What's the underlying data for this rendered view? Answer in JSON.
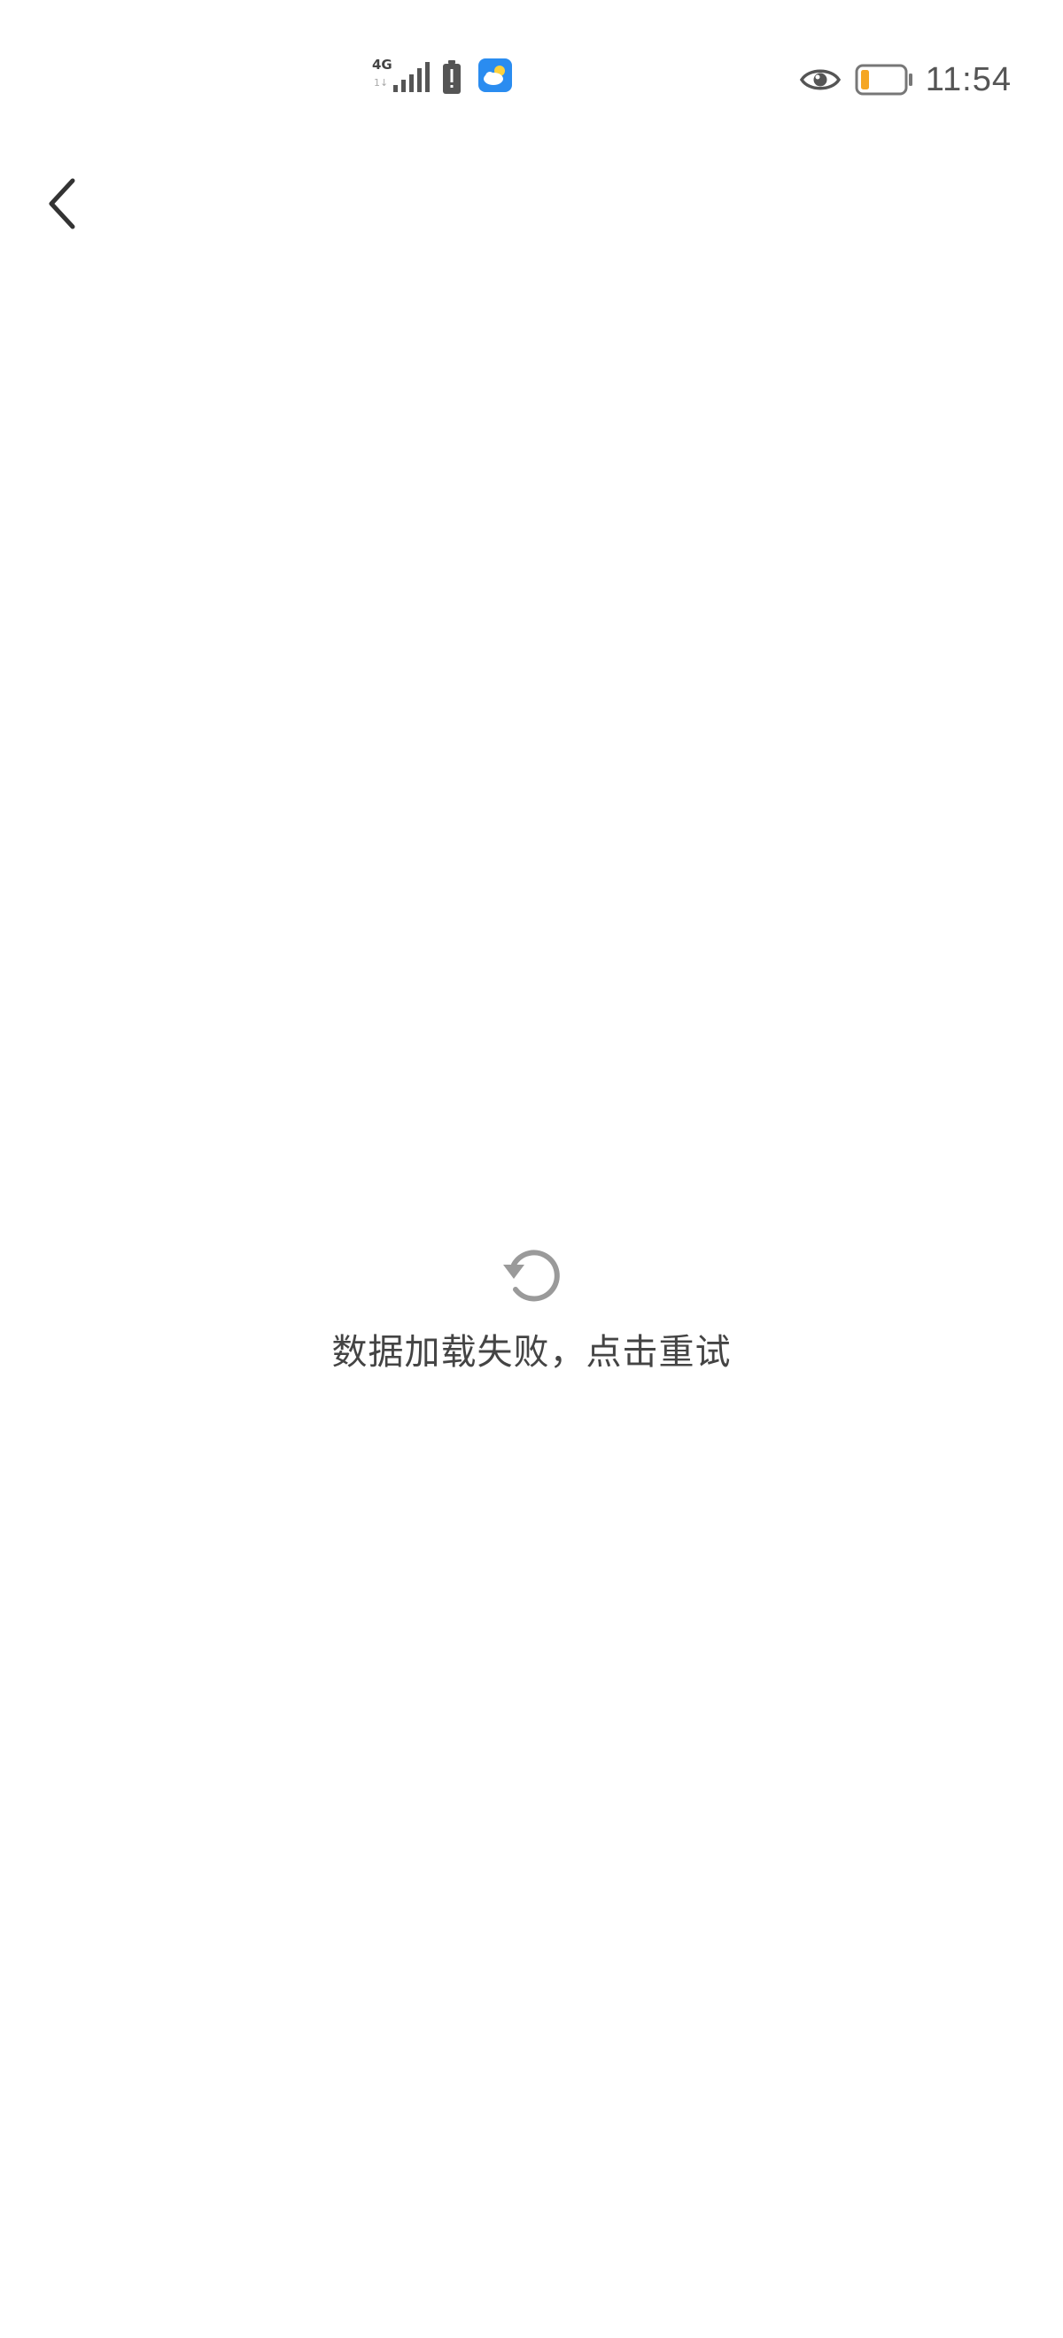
{
  "status_bar": {
    "network_type": "4G",
    "network_sub": "1↓",
    "time": "11:54",
    "icons": [
      "signal-icon",
      "battery-alert-icon",
      "weather-app-icon",
      "eye-icon",
      "battery-icon"
    ],
    "battery_level_color": "#f5a623",
    "weather_app_color": "#2a8cf0"
  },
  "nav": {
    "back_icon": "chevron-left-icon"
  },
  "error_state": {
    "icon": "refresh-icon",
    "message": "数据加载失败，点击重试",
    "icon_color": "#9a9a9a"
  }
}
